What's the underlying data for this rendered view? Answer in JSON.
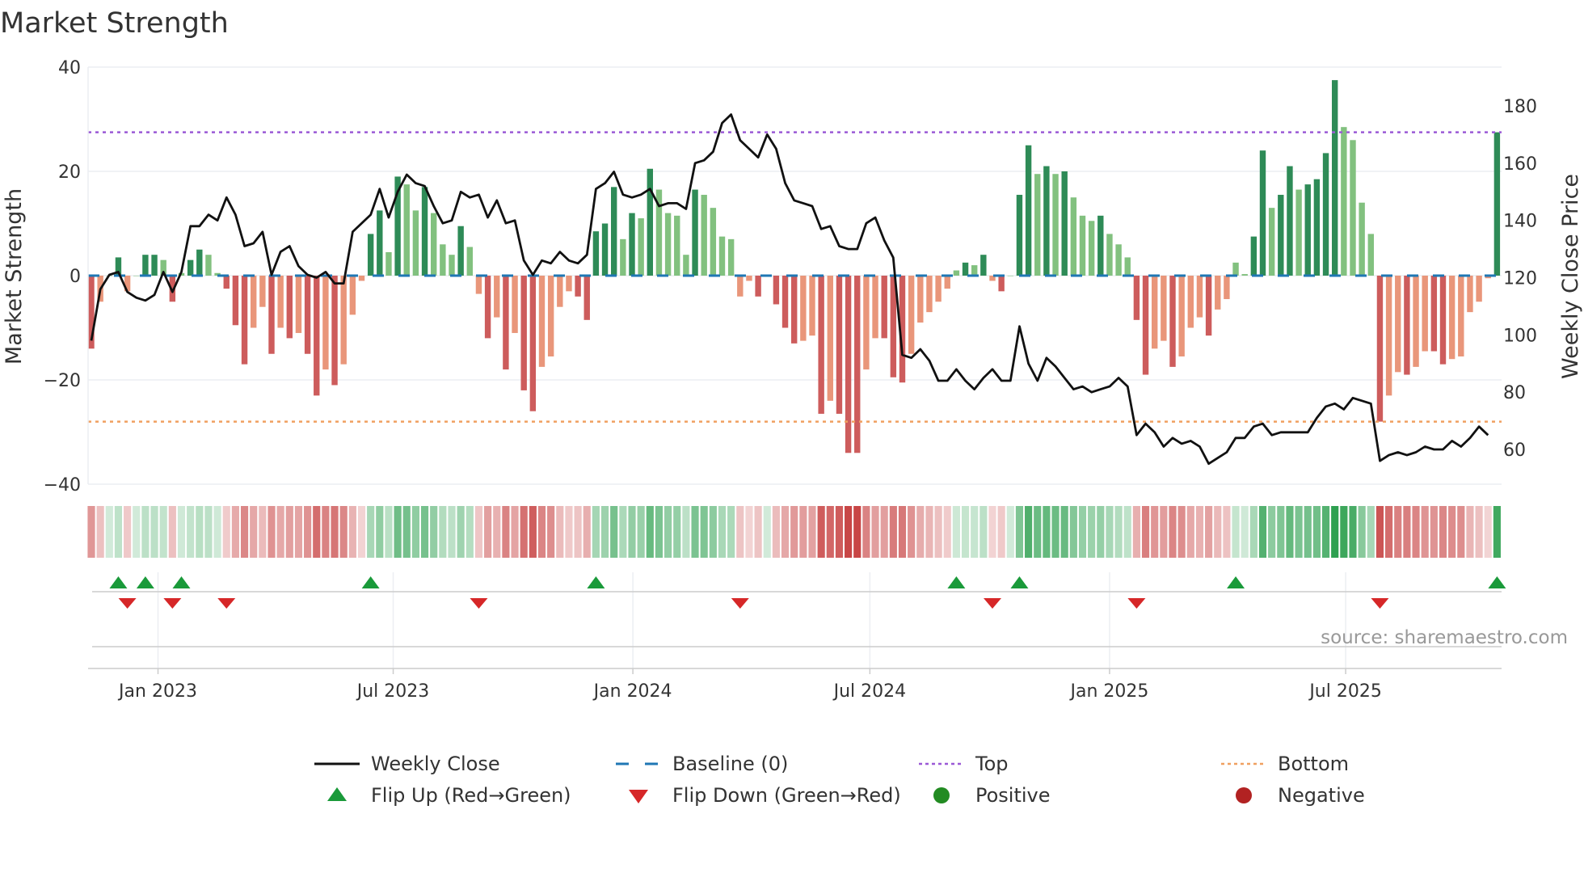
{
  "chart_data": {
    "type": "bar",
    "title": "Market Strength",
    "ylabel": "Market Strength",
    "y2label": "Weekly Close Price",
    "ylim": [
      -40,
      40
    ],
    "y2lim": [
      60,
      180
    ],
    "yticks": [
      40,
      20,
      0,
      -20,
      -40
    ],
    "ytick_labels": [
      "40",
      "20",
      "0",
      "−20",
      "−40"
    ],
    "y2ticks": [
      60,
      80,
      100,
      120,
      140,
      160,
      180
    ],
    "y2tick_labels": [
      "60",
      "80",
      "100",
      "120",
      "140",
      "160",
      "180"
    ],
    "xticks": [
      {
        "week": 7.4,
        "label": "Jan 2023"
      },
      {
        "week": 33.5,
        "label": "Jul 2023"
      },
      {
        "week": 60.1,
        "label": "Jan 2024"
      },
      {
        "week": 86.4,
        "label": "Jul 2024"
      },
      {
        "week": 113,
        "label": "Jan 2025"
      },
      {
        "week": 139.2,
        "label": "Jul 2025"
      }
    ],
    "top_level": 27.5,
    "bottom_level": -28,
    "baseline": 0,
    "strength": [
      -14,
      -5,
      0,
      3.5,
      -3,
      0,
      4,
      4,
      3,
      -5,
      0.5,
      3,
      5,
      4,
      0.5,
      -2.5,
      -9.5,
      -17,
      -10,
      -6,
      -15,
      -10,
      -12,
      -11,
      -15,
      -23,
      -18,
      -21,
      -17,
      -7.5,
      -1,
      8,
      12.5,
      4.5,
      19,
      17.5,
      12.5,
      17,
      12,
      6,
      4,
      9.5,
      5.5,
      -3.5,
      -12,
      -8,
      -18,
      -11,
      -22,
      -26,
      -17.5,
      -15.5,
      -6,
      -3,
      -4,
      -8.5,
      8.5,
      10,
      17,
      7,
      12,
      11,
      20.5,
      16.5,
      12,
      11.5,
      4,
      16.5,
      15.5,
      13,
      7.5,
      7,
      -4,
      -1,
      -4,
      0,
      -5.5,
      -10,
      -13,
      -12.5,
      -11.5,
      -26.5,
      -24,
      -26.5,
      -34,
      -34,
      -18,
      -12,
      -12,
      -19.5,
      -20.5,
      -15,
      -9,
      -7,
      -5,
      -2.5,
      1,
      2.5,
      2,
      4,
      -1,
      -3,
      0,
      15.5,
      25,
      19.5,
      21,
      19.5,
      20,
      15,
      11.5,
      10.5,
      11.5,
      8,
      6,
      3.5,
      -8.5,
      -19,
      -14,
      -12.5,
      -17.5,
      -15.5,
      -10,
      -8,
      -11.5,
      -6.5,
      -4.5,
      2.5,
      0.3,
      7.5,
      24,
      13,
      15.5,
      21,
      16.5,
      17.5,
      18.5,
      23.5,
      37.5,
      28.5,
      26,
      14,
      8,
      -28,
      -23,
      -18.5,
      -19,
      -17.5,
      -14.5,
      -14.5,
      -17,
      -16,
      -15.5,
      -7,
      -5,
      -0.5,
      27.5
    ],
    "weekly_close": [
      98,
      116,
      121,
      122,
      115,
      113,
      112,
      114,
      122,
      115,
      122,
      138,
      138,
      142,
      140,
      148,
      142,
      131,
      132,
      136,
      121,
      129,
      131,
      124,
      121,
      120,
      122,
      118,
      118,
      136,
      139,
      142,
      151,
      141,
      150,
      156,
      153,
      152,
      145,
      139,
      140,
      150,
      148,
      149,
      141,
      147,
      139,
      140,
      126,
      121,
      126,
      125,
      129,
      126,
      125,
      128,
      151,
      153,
      157,
      149,
      148,
      149,
      151,
      145,
      146,
      146,
      144,
      160,
      161,
      164,
      174,
      177,
      168,
      165,
      162,
      170,
      165,
      153,
      147,
      146,
      145,
      137,
      138,
      131,
      130,
      130,
      139,
      141,
      133,
      127,
      93,
      92,
      95,
      91,
      84,
      84,
      88,
      84,
      81,
      85,
      88,
      84,
      84,
      103,
      90,
      84,
      92,
      89,
      85,
      81,
      82,
      80,
      81,
      82,
      85,
      82,
      65,
      69,
      66,
      61,
      64,
      62,
      63,
      61,
      55,
      57,
      59,
      64,
      64,
      68,
      69,
      65,
      66,
      66,
      66,
      66,
      71,
      75,
      76,
      74,
      78,
      77,
      76,
      56,
      58,
      59,
      58,
      59,
      61,
      60,
      60,
      63,
      61,
      64,
      68,
      65
    ],
    "flip_up_weeks": [
      3,
      6,
      10,
      31,
      56,
      96,
      103,
      127,
      156
    ],
    "flip_down_weeks": [
      4,
      9,
      15,
      43,
      72,
      100,
      116,
      143
    ],
    "legend": {
      "weekly_close": "Weekly Close",
      "baseline": "Baseline (0)",
      "top": "Top",
      "bottom": "Bottom",
      "flip_up": "Flip Up (Red→Green)",
      "flip_down": "Flip Down (Green→Red)",
      "positive": "Positive",
      "negative": "Negative"
    },
    "legend_placement": "bottom",
    "source": "source: sharemaestro.com",
    "colors": {
      "pos_dark": "#2e8b57",
      "pos_light": "#82c17f",
      "neg_dark": "#cd5c5c",
      "neg_light": "#e9967a",
      "close": "#111111",
      "baseline": "#1f77b4",
      "top": "#9b59d6",
      "bottom": "#f0a060",
      "flip_up": "#1a9a3a",
      "flip_down": "#d62728",
      "positive": "#228b22",
      "negative": "#b22222"
    }
  }
}
